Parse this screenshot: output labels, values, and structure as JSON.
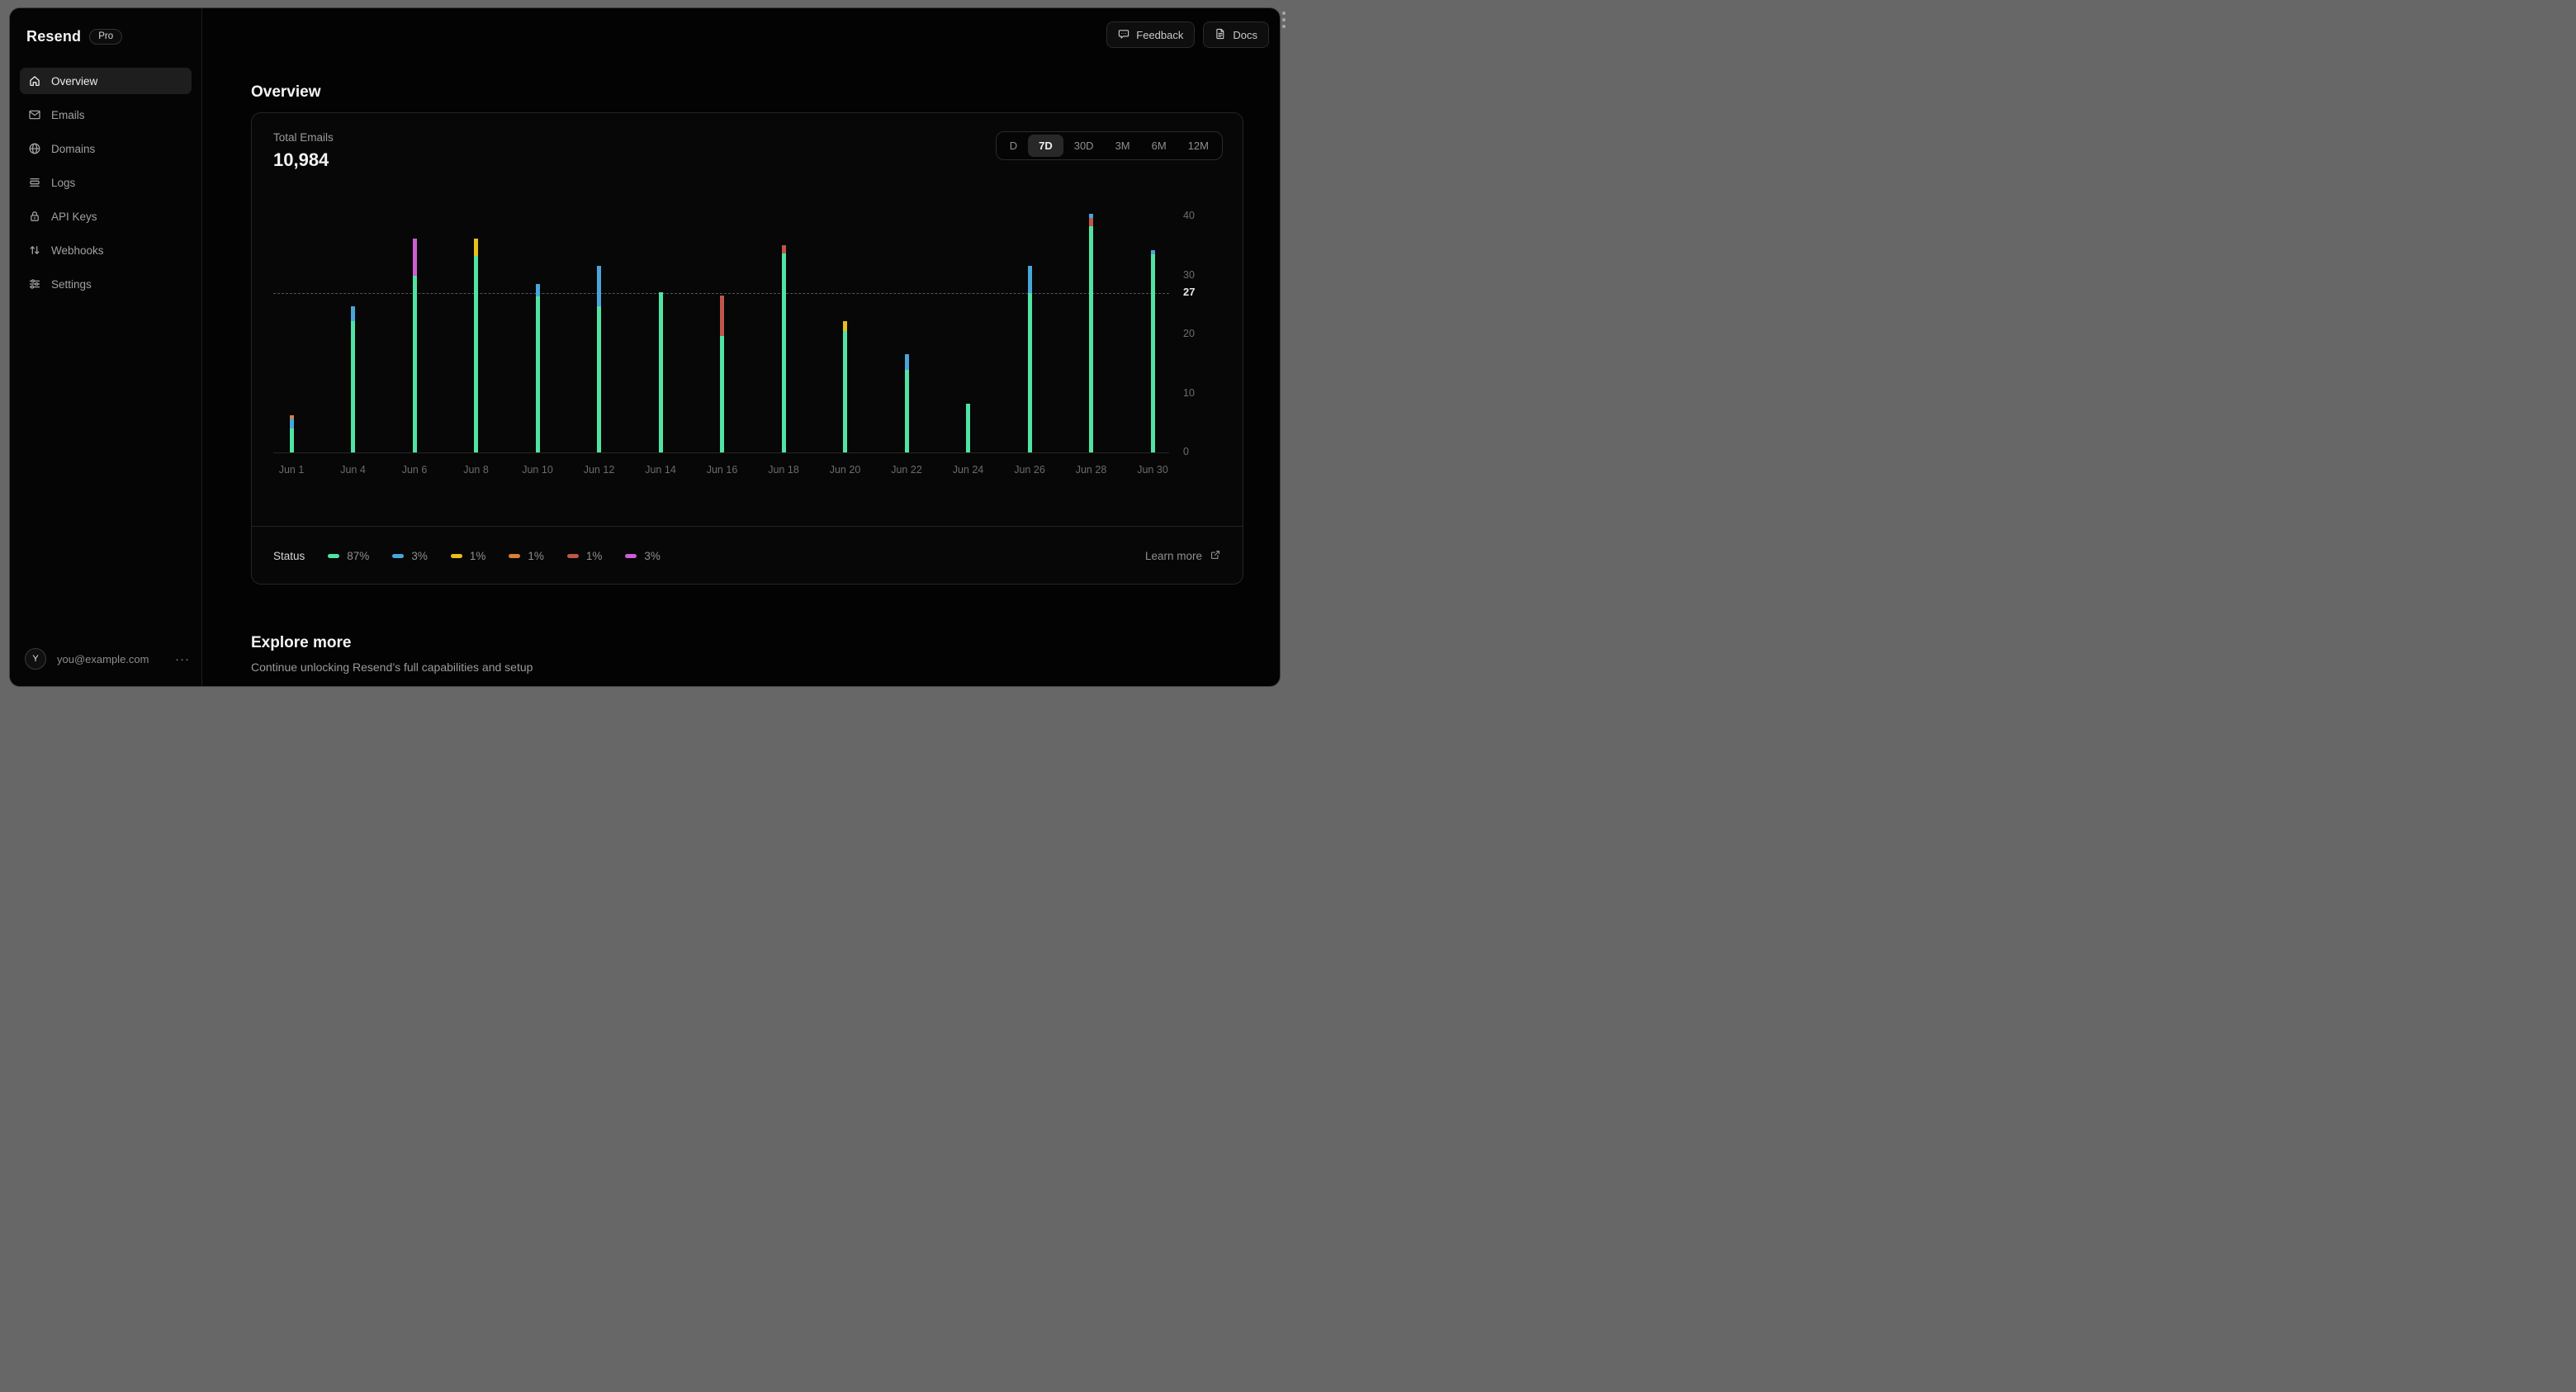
{
  "brand": {
    "name": "Resend",
    "badge": "Pro"
  },
  "sidebar": {
    "items": [
      {
        "label": "Overview",
        "icon": "home-icon",
        "active": true
      },
      {
        "label": "Emails",
        "icon": "mail-icon",
        "active": false
      },
      {
        "label": "Domains",
        "icon": "globe-icon",
        "active": false
      },
      {
        "label": "Logs",
        "icon": "logs-icon",
        "active": false
      },
      {
        "label": "API Keys",
        "icon": "lock-icon",
        "active": false
      },
      {
        "label": "Webhooks",
        "icon": "arrows-up-down-icon",
        "active": false
      },
      {
        "label": "Settings",
        "icon": "sliders-icon",
        "active": false
      }
    ],
    "account": {
      "avatar_letter": "Y",
      "email": "you@example.com",
      "menu": "···"
    }
  },
  "header": {
    "buttons": [
      {
        "label": "Feedback",
        "icon": "feedback-icon"
      },
      {
        "label": "Docs",
        "icon": "docs-icon"
      }
    ]
  },
  "page": {
    "title": "Overview"
  },
  "card": {
    "metric_label": "Total Emails",
    "metric_value": "10,984",
    "ranges": [
      {
        "label": "D",
        "active": false
      },
      {
        "label": "7D",
        "active": true
      },
      {
        "label": "30D",
        "active": false
      },
      {
        "label": "3M",
        "active": false
      },
      {
        "label": "6M",
        "active": false
      },
      {
        "label": "12M",
        "active": false
      }
    ],
    "footer": {
      "status_label": "Status",
      "learn_more": "Learn more"
    }
  },
  "chart_data": {
    "type": "bar",
    "stacked": true,
    "title": "Total Emails",
    "total_label": "10,984",
    "categories": [
      "Jun 1",
      "Jun 4",
      "Jun 6",
      "Jun 8",
      "Jun 10",
      "Jun 12",
      "Jun 14",
      "Jun 16",
      "Jun 18",
      "Jun 20",
      "Jun 22",
      "Jun 24",
      "Jun 26",
      "Jun 28",
      "Jun 30"
    ],
    "ylim": [
      0,
      42
    ],
    "yticks": [
      0,
      10,
      20,
      30,
      40
    ],
    "reference_line": {
      "value": 27,
      "label": "27"
    },
    "grid": "off",
    "legend_position": "bottom-left",
    "colors": {
      "green": "#50e3a4",
      "blue": "#4aa5d9",
      "yellow": "#e7c019",
      "orange": "#dd7d3d",
      "red": "#bf564c",
      "magenta": "#cf5cd7"
    },
    "bars": [
      {
        "label": "Jun 1",
        "segments": [
          {
            "status": "green",
            "value": 4.0
          },
          {
            "status": "blue",
            "value": 1.7
          },
          {
            "status": "orange",
            "value": 0.6
          }
        ]
      },
      {
        "label": "Jun 4",
        "segments": [
          {
            "status": "green",
            "value": 22.3
          },
          {
            "status": "blue",
            "value": 2.5
          }
        ]
      },
      {
        "label": "Jun 6",
        "segments": [
          {
            "status": "green",
            "value": 30.0
          },
          {
            "status": "magenta",
            "value": 6.2
          }
        ]
      },
      {
        "label": "Jun 8",
        "segments": [
          {
            "status": "green",
            "value": 33.3
          },
          {
            "status": "yellow",
            "value": 3.0
          }
        ]
      },
      {
        "label": "Jun 10",
        "segments": [
          {
            "status": "green",
            "value": 26.5
          },
          {
            "status": "blue",
            "value": 2.0
          }
        ]
      },
      {
        "label": "Jun 12",
        "segments": [
          {
            "status": "green",
            "value": 24.8
          },
          {
            "status": "blue",
            "value": 6.8
          }
        ]
      },
      {
        "label": "Jun 14",
        "segments": [
          {
            "status": "green",
            "value": 27.2
          }
        ]
      },
      {
        "label": "Jun 16",
        "segments": [
          {
            "status": "green",
            "value": 19.8
          },
          {
            "status": "red",
            "value": 6.8
          }
        ]
      },
      {
        "label": "Jun 18",
        "segments": [
          {
            "status": "green",
            "value": 33.8
          },
          {
            "status": "red",
            "value": 1.4
          }
        ]
      },
      {
        "label": "Jun 20",
        "segments": [
          {
            "status": "green",
            "value": 20.6
          },
          {
            "status": "yellow",
            "value": 1.6
          }
        ]
      },
      {
        "label": "Jun 22",
        "segments": [
          {
            "status": "green",
            "value": 14.0
          },
          {
            "status": "blue",
            "value": 2.6
          }
        ]
      },
      {
        "label": "Jun 24",
        "segments": [
          {
            "status": "green",
            "value": 8.2
          }
        ]
      },
      {
        "label": "Jun 26",
        "segments": [
          {
            "status": "green",
            "value": 27.0
          },
          {
            "status": "blue",
            "value": 4.6
          }
        ]
      },
      {
        "label": "Jun 28",
        "segments": [
          {
            "status": "green",
            "value": 38.3
          },
          {
            "status": "red",
            "value": 1.4
          },
          {
            "status": "blue",
            "value": 0.7
          }
        ]
      },
      {
        "label": "Jun 30",
        "segments": [
          {
            "status": "green",
            "value": 33.6
          },
          {
            "status": "blue",
            "value": 0.7
          }
        ]
      }
    ],
    "legend": [
      {
        "color": "green",
        "percent": "87%"
      },
      {
        "color": "blue",
        "percent": "3%"
      },
      {
        "color": "yellow",
        "percent": "1%"
      },
      {
        "color": "orange",
        "percent": "1%"
      },
      {
        "color": "red",
        "percent": "1%"
      },
      {
        "color": "magenta",
        "percent": "3%"
      }
    ]
  },
  "explore": {
    "title": "Explore more",
    "subtitle": "Continue unlocking Resend’s full capabilities and setup"
  }
}
